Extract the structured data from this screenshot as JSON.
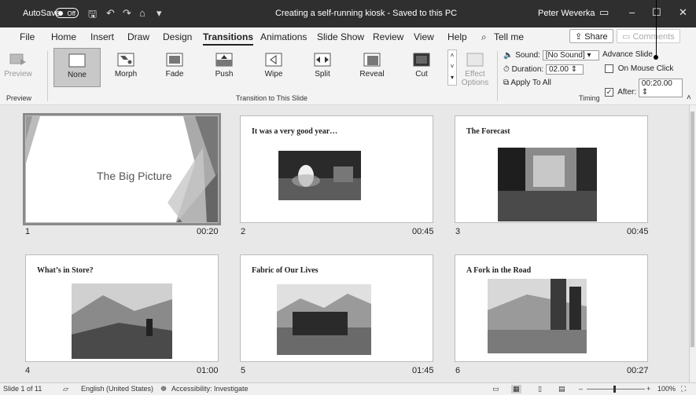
{
  "titlebar": {
    "autosave_label": "AutoSave",
    "autosave_state": "Off",
    "doc_title": "Creating a self-running kiosk - Saved to this PC",
    "user": "Peter Weverka"
  },
  "menu": {
    "tabs": [
      "File",
      "Home",
      "Insert",
      "Draw",
      "Design",
      "Transitions",
      "Animations",
      "Slide Show",
      "Review",
      "View",
      "Help"
    ],
    "active_tab": "Transitions",
    "tell_me": "Tell me",
    "share": "Share",
    "comments": "Comments"
  },
  "ribbon": {
    "preview_label": "Preview",
    "preview_group": "Preview",
    "transitions": [
      "None",
      "Morph",
      "Fade",
      "Push",
      "Wipe",
      "Split",
      "Reveal",
      "Cut"
    ],
    "selected_transition": "None",
    "transition_group": "Transition to This Slide",
    "effect_options": "Effect Options",
    "sound_label": "Sound:",
    "sound_value": "[No Sound]",
    "duration_label": "Duration:",
    "duration_value": "02.00",
    "apply_all": "Apply To All",
    "advance_label": "Advance Slide",
    "on_click_label": "On Mouse Click",
    "on_click_checked": false,
    "after_label": "After:",
    "after_checked": true,
    "after_value": "00:20.00",
    "timing_group": "Timing"
  },
  "slides": [
    {
      "number": "1",
      "title": "The Big Picture",
      "time": "00:20",
      "selected": true
    },
    {
      "number": "2",
      "title": "It was a very good year…",
      "time": "00:45"
    },
    {
      "number": "3",
      "title": "The Forecast",
      "time": "00:45"
    },
    {
      "number": "4",
      "title": "What’s in Store?",
      "time": "01:00"
    },
    {
      "number": "5",
      "title": "Fabric of Our Lives",
      "time": "01:45"
    },
    {
      "number": "6",
      "title": "A Fork in the Road",
      "time": "00:27"
    }
  ],
  "status": {
    "slide_count": "Slide 1 of 11",
    "language": "English (United States)",
    "accessibility": "Accessibility: Investigate",
    "zoom": "100%"
  }
}
